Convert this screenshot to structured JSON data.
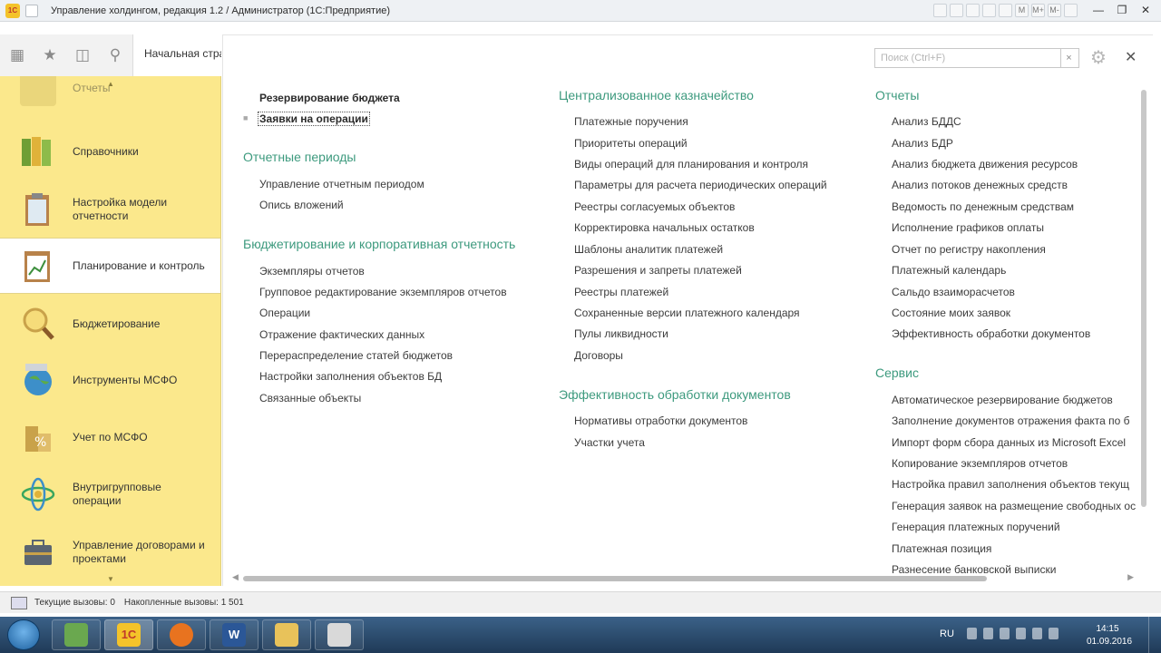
{
  "window": {
    "title": "Управление холдингом, редакция 1.2 / Администратор  (1С:Предприятие)",
    "logo_text": "1С",
    "tool_letters": [
      "M",
      "M+",
      "M-"
    ]
  },
  "toolbar": {
    "start_tab_label": "Начальная стра"
  },
  "sidebar": {
    "items": [
      {
        "label": "Отчеты",
        "icon": "reports-icon",
        "color": "#d9c46a"
      },
      {
        "label": "Справочники",
        "icon": "books-icon",
        "color": "#7bae3a"
      },
      {
        "label": "Настройка модели отчетности",
        "icon": "clipboard-icon",
        "color": "#a9c5d8"
      },
      {
        "label": "Планирование и контроль",
        "icon": "planning-icon",
        "color": "#c9a35a",
        "active": true
      },
      {
        "label": "Бюджетирование",
        "icon": "magnifier-icon",
        "color": "#e0b23a"
      },
      {
        "label": "Инструменты МСФО",
        "icon": "globe-icon",
        "color": "#3d8fc9"
      },
      {
        "label": "Учет по МСФО",
        "icon": "coins-icon",
        "color": "#c9a24a"
      },
      {
        "label": "Внутригрупповые операции",
        "icon": "atom-icon",
        "color": "#3aa65e"
      },
      {
        "label": "Управление договорами и проектами",
        "icon": "briefcase-icon",
        "color": "#5b6570"
      }
    ]
  },
  "search": {
    "placeholder": "Поиск (Ctrl+F)",
    "clear_symbol": "×"
  },
  "columns": {
    "col1": {
      "top_links": [
        "Резервирование бюджета",
        "Заявки на операции"
      ],
      "sections": [
        {
          "title": "Отчетные периоды",
          "links": [
            "Управление отчетным периодом",
            "Опись вложений"
          ]
        },
        {
          "title": "Бюджетирование и корпоративная отчетность",
          "links": [
            "Экземпляры отчетов",
            "Групповое редактирование экземпляров отчетов",
            "Операции",
            "Отражение фактических данных",
            "Перераспределение статей бюджетов",
            "Настройки заполнения объектов БД",
            "Связанные объекты"
          ]
        }
      ]
    },
    "col2": {
      "sections": [
        {
          "title": "Централизованное казначейство",
          "links": [
            "Платежные поручения",
            "Приоритеты операций",
            "Виды операций для планирования и контроля",
            "Параметры для расчета периодических операций",
            "Реестры согласуемых объектов",
            "Корректировка начальных остатков",
            "Шаблоны аналитик платежей",
            "Разрешения и запреты платежей",
            "Реестры платежей",
            "Сохраненные версии платежного календаря",
            "Пулы ликвидности",
            "Договоры"
          ]
        },
        {
          "title": "Эффективность обработки документов",
          "links": [
            "Нормативы отработки документов",
            "Участки учета"
          ]
        }
      ]
    },
    "col3": {
      "sections": [
        {
          "title": "Отчеты",
          "links": [
            "Анализ БДДС",
            "Анализ БДР",
            "Анализ бюджета движения ресурсов",
            "Анализ потоков денежных средств",
            "Ведомость по денежным средствам",
            "Исполнение графиков оплаты",
            "Отчет по регистру накопления",
            "Платежный календарь",
            "Сальдо взаиморасчетов",
            "Состояние моих заявок",
            "Эффективность обработки документов"
          ]
        },
        {
          "title": "Сервис",
          "links": [
            "Автоматическое резервирование бюджетов",
            "Заполнение документов отражения факта по б",
            "Импорт форм сбора данных из Microsoft Excel",
            "Копирование экземпляров отчетов",
            "Настройка правил заполнения объектов текущ",
            "Генерация заявок на размещение свободных ос",
            "Генерация платежных поручений",
            "Платежная позиция",
            "Разнесение банковской выписки"
          ]
        }
      ]
    }
  },
  "status": {
    "current_calls": "Текущие вызовы: 0",
    "accumulated_calls": "Накопленные вызовы: 1 501"
  },
  "taskbar": {
    "language": "RU",
    "time": "14:15",
    "date": "01.09.2016",
    "apps": [
      {
        "name": "file-manager",
        "label": "",
        "color": "#6aa84f"
      },
      {
        "name": "1c",
        "label": "1С",
        "color": "#f4c32a",
        "active": true
      },
      {
        "name": "firefox",
        "label": "",
        "color": "#e8731f"
      },
      {
        "name": "word",
        "label": "W",
        "color": "#2b5797"
      },
      {
        "name": "explorer",
        "label": "",
        "color": "#e8c25a"
      },
      {
        "name": "paint",
        "label": "",
        "color": "#d9d9d9"
      }
    ]
  }
}
